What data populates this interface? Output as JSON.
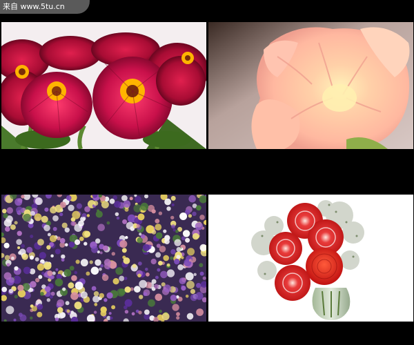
{
  "watermark": {
    "text": "来自 www.5tu.cn"
  },
  "colors": {
    "background": "#000000",
    "watermark_bg": "#5a5a5a",
    "watermark_text": "#ffffff"
  },
  "photos": [
    {
      "subject": "zinnia-bouquet-photo"
    },
    {
      "subject": "peach-lisianthus-closeup-photo"
    },
    {
      "subject": "statice-wildflower-field-photo"
    },
    {
      "subject": "red-dahlia-vase-arrangement-photo"
    }
  ]
}
